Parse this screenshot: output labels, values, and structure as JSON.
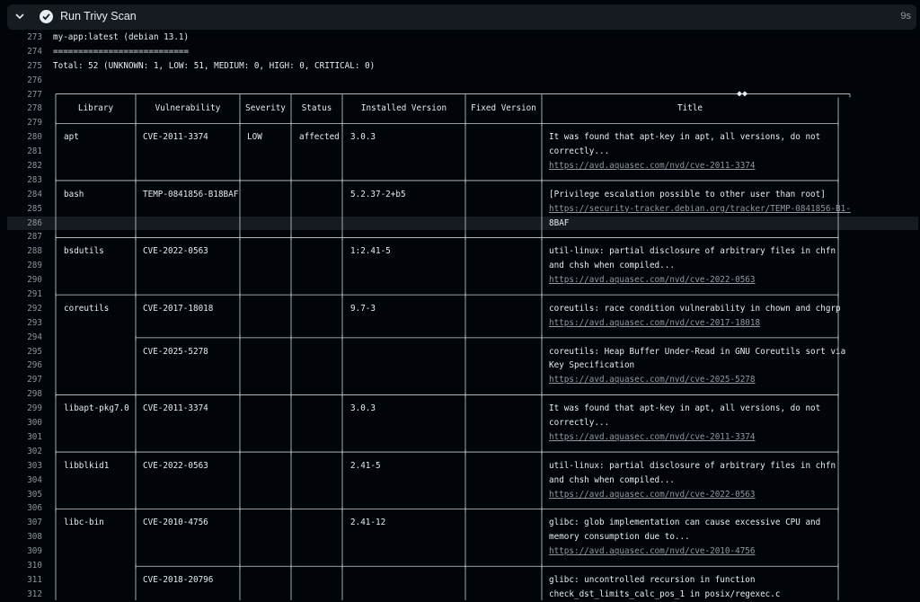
{
  "step": {
    "title": "Run Trivy Scan",
    "duration": "9s"
  },
  "lines": [
    {
      "n": "273",
      "text": "my-app:latest (debian 13.1)"
    },
    {
      "n": "274",
      "text": "==========================="
    },
    {
      "n": "275",
      "text": "Total: 52 (UNKNOWN: 1, LOW: 51, MEDIUM: 0, HIGH: 0, CRITICAL: 0)"
    },
    {
      "n": "276",
      "text": ""
    },
    {
      "n": "277",
      "text": ""
    },
    {
      "n": "278",
      "text": ""
    },
    {
      "n": "279",
      "text": ""
    },
    {
      "n": "280",
      "text": ""
    },
    {
      "n": "281",
      "text": ""
    },
    {
      "n": "282",
      "text": ""
    },
    {
      "n": "283",
      "text": ""
    },
    {
      "n": "284",
      "text": ""
    },
    {
      "n": "285",
      "text": ""
    },
    {
      "n": "286",
      "text": ""
    },
    {
      "n": "287",
      "text": ""
    },
    {
      "n": "288",
      "text": ""
    },
    {
      "n": "289",
      "text": ""
    },
    {
      "n": "290",
      "text": ""
    },
    {
      "n": "291",
      "text": ""
    },
    {
      "n": "292",
      "text": ""
    },
    {
      "n": "293",
      "text": ""
    },
    {
      "n": "294",
      "text": ""
    },
    {
      "n": "295",
      "text": ""
    },
    {
      "n": "296",
      "text": ""
    },
    {
      "n": "297",
      "text": ""
    },
    {
      "n": "298",
      "text": ""
    },
    {
      "n": "299",
      "text": ""
    },
    {
      "n": "300",
      "text": ""
    },
    {
      "n": "301",
      "text": ""
    },
    {
      "n": "302",
      "text": ""
    },
    {
      "n": "303",
      "text": ""
    },
    {
      "n": "304",
      "text": ""
    },
    {
      "n": "305",
      "text": ""
    },
    {
      "n": "306",
      "text": ""
    },
    {
      "n": "307",
      "text": ""
    },
    {
      "n": "308",
      "text": ""
    },
    {
      "n": "309",
      "text": ""
    },
    {
      "n": "310",
      "text": ""
    },
    {
      "n": "311",
      "text": ""
    },
    {
      "n": "312",
      "text": ""
    }
  ],
  "table": {
    "headers": [
      "Library",
      "Vulnerability",
      "Severity",
      "Status",
      "Installed Version",
      "Fixed Version",
      "Title"
    ],
    "diamond": "◆◆",
    "cells": [
      {
        "line": 7,
        "col": 0,
        "text": "apt"
      },
      {
        "line": 7,
        "col": 1,
        "text": "CVE-2011-3374"
      },
      {
        "line": 7,
        "col": 2,
        "text": "LOW"
      },
      {
        "line": 7,
        "col": 3,
        "text": "affected"
      },
      {
        "line": 7,
        "col": 4,
        "text": "3.0.3"
      },
      {
        "line": 7,
        "col": 6,
        "text": "It was found that apt-key in apt, all versions, do not"
      },
      {
        "line": 8,
        "col": 6,
        "text": "correctly..."
      },
      {
        "line": 9,
        "col": 6,
        "text": "https://avd.aquasec.com/nvd/cve-2011-3374",
        "link": true
      },
      {
        "line": 11,
        "col": 0,
        "text": "bash"
      },
      {
        "line": 11,
        "col": 1,
        "text": "TEMP-0841856-B18BAF"
      },
      {
        "line": 11,
        "col": 4,
        "text": "5.2.37-2+b5"
      },
      {
        "line": 11,
        "col": 6,
        "text": "[Privilege escalation possible to other user than root]"
      },
      {
        "line": 12,
        "col": 6,
        "text": "https://security-tracker.debian.org/tracker/TEMP-0841856-B1-",
        "link": true
      },
      {
        "line": 13,
        "col": 6,
        "text": "8BAF"
      },
      {
        "line": 15,
        "col": 0,
        "text": "bsdutils"
      },
      {
        "line": 15,
        "col": 1,
        "text": "CVE-2022-0563"
      },
      {
        "line": 15,
        "col": 4,
        "text": "1:2.41-5"
      },
      {
        "line": 15,
        "col": 6,
        "text": "util-linux: partial disclosure of arbitrary files in chfn"
      },
      {
        "line": 16,
        "col": 6,
        "text": "and chsh when compiled..."
      },
      {
        "line": 17,
        "col": 6,
        "text": "https://avd.aquasec.com/nvd/cve-2022-0563",
        "link": true
      },
      {
        "line": 19,
        "col": 0,
        "text": "coreutils"
      },
      {
        "line": 19,
        "col": 1,
        "text": "CVE-2017-18018"
      },
      {
        "line": 19,
        "col": 4,
        "text": "9.7-3"
      },
      {
        "line": 19,
        "col": 6,
        "text": "coreutils: race condition vulnerability in chown and chgrp"
      },
      {
        "line": 20,
        "col": 6,
        "text": "https://avd.aquasec.com/nvd/cve-2017-18018",
        "link": true
      },
      {
        "line": 22,
        "col": 1,
        "text": "CVE-2025-5278"
      },
      {
        "line": 22,
        "col": 6,
        "text": "coreutils: Heap Buffer Under-Read in GNU Coreutils sort via"
      },
      {
        "line": 23,
        "col": 6,
        "text": "Key Specification"
      },
      {
        "line": 24,
        "col": 6,
        "text": "https://avd.aquasec.com/nvd/cve-2025-5278",
        "link": true
      },
      {
        "line": 26,
        "col": 0,
        "text": "libapt-pkg7.0"
      },
      {
        "line": 26,
        "col": 1,
        "text": "CVE-2011-3374"
      },
      {
        "line": 26,
        "col": 4,
        "text": "3.0.3"
      },
      {
        "line": 26,
        "col": 6,
        "text": "It was found that apt-key in apt, all versions, do not"
      },
      {
        "line": 27,
        "col": 6,
        "text": "correctly..."
      },
      {
        "line": 28,
        "col": 6,
        "text": "https://avd.aquasec.com/nvd/cve-2011-3374",
        "link": true
      },
      {
        "line": 30,
        "col": 0,
        "text": "libblkid1"
      },
      {
        "line": 30,
        "col": 1,
        "text": "CVE-2022-0563"
      },
      {
        "line": 30,
        "col": 4,
        "text": "2.41-5"
      },
      {
        "line": 30,
        "col": 6,
        "text": "util-linux: partial disclosure of arbitrary files in chfn"
      },
      {
        "line": 31,
        "col": 6,
        "text": "and chsh when compiled..."
      },
      {
        "line": 32,
        "col": 6,
        "text": "https://avd.aquasec.com/nvd/cve-2022-0563",
        "link": true
      },
      {
        "line": 34,
        "col": 0,
        "text": "libc-bin"
      },
      {
        "line": 34,
        "col": 1,
        "text": "CVE-2010-4756"
      },
      {
        "line": 34,
        "col": 4,
        "text": "2.41-12"
      },
      {
        "line": 34,
        "col": 6,
        "text": "glibc: glob implementation can cause excessive CPU and"
      },
      {
        "line": 35,
        "col": 6,
        "text": "memory consumption due to..."
      },
      {
        "line": 36,
        "col": 6,
        "text": "https://avd.aquasec.com/nvd/cve-2010-4756",
        "link": true
      },
      {
        "line": 38,
        "col": 1,
        "text": "CVE-2018-20796"
      },
      {
        "line": 38,
        "col": 6,
        "text": "glibc: uncontrolled recursion in function"
      },
      {
        "line": 39,
        "col": 6,
        "text": "check_dst_limits_calc_pos_1 in posix/regexec.c"
      }
    ]
  },
  "colors": {
    "background": "#010409",
    "header": "#161b22",
    "text": "#e6edf3",
    "muted": "#8b949e"
  }
}
